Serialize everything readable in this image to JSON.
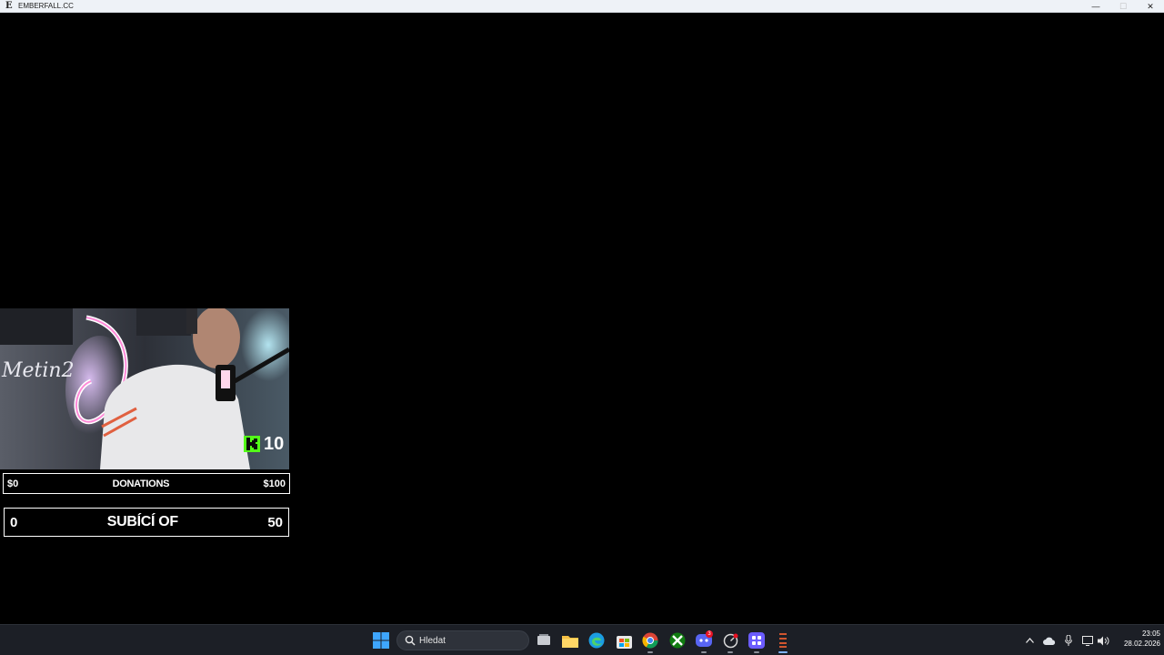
{
  "window": {
    "title": "EMBERFALL.CC",
    "app_icon_letter": "E",
    "controls": {
      "minimize": "—",
      "maximize": "☐",
      "close": "✕"
    }
  },
  "stream": {
    "webcam_sign_text": "Metin2",
    "kick_viewers": "10"
  },
  "goals": {
    "donations": {
      "left": "$0",
      "label": "DONATIONS",
      "right": "$100"
    },
    "subs": {
      "left": "0",
      "label": "SUBÍCÍ OF",
      "right": "50"
    }
  },
  "taskbar": {
    "search_placeholder": "Hledat",
    "apps": [
      "windows-start",
      "file-explorer",
      "task-view",
      "edge",
      "microsoft-store",
      "chrome",
      "xbox",
      "discord",
      "cpu-monitor",
      "launcher",
      "emberfall"
    ],
    "discord_badge": "3",
    "time": "23:05",
    "date": "28.02.2026"
  },
  "colors": {
    "kick_green": "#53fc18",
    "taskbar_bg": "#1c1f26",
    "accent": "#0078d4"
  }
}
